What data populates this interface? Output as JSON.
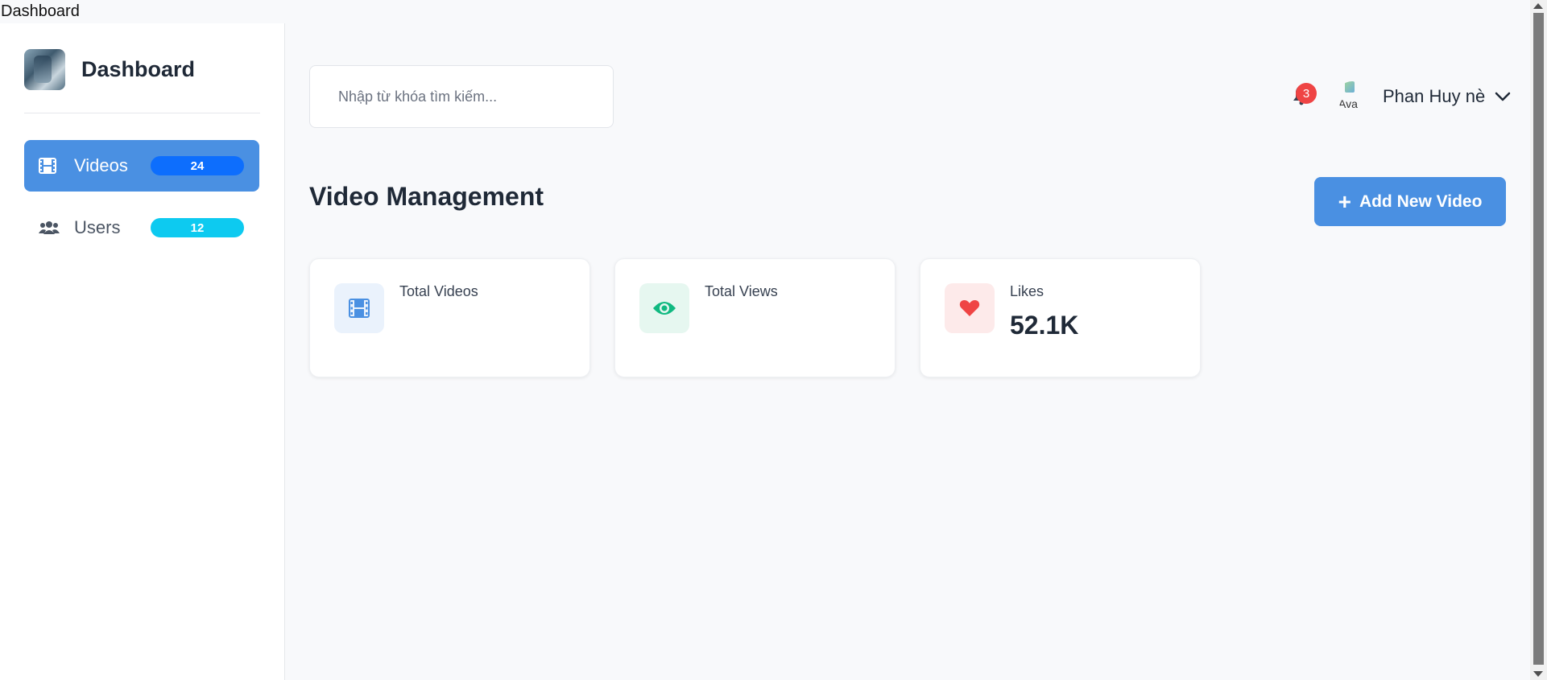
{
  "document_title": "Dashboard",
  "brand": {
    "name": "Dashboard"
  },
  "sidebar": {
    "items": [
      {
        "label": "Videos",
        "badge": "24",
        "icon": "film-icon",
        "active": true,
        "badge_color": "#0d6efd"
      },
      {
        "label": "Users",
        "badge": "12",
        "icon": "users-icon",
        "active": false,
        "badge_color": "#0dcaf0"
      }
    ]
  },
  "search": {
    "placeholder": "Nhập từ khóa tìm kiếm...",
    "value": ""
  },
  "header": {
    "notifications_count": "3",
    "avatar_alt": "Ava",
    "user_name": "Phan Huy nè"
  },
  "main": {
    "title": "Video Management",
    "add_button_label": "Add New Video",
    "stats": [
      {
        "label": "Total Videos",
        "value": "",
        "icon": "film-icon",
        "color": "#4a90e2",
        "bg": "#eaf2fc"
      },
      {
        "label": "Total Views",
        "value": "",
        "icon": "eye-icon",
        "color": "#10b981",
        "bg": "#e6f7f0"
      },
      {
        "label": "Likes",
        "value": "52.1K",
        "icon": "heart-icon",
        "color": "#ef4444",
        "bg": "#fdeaea"
      }
    ]
  },
  "colors": {
    "accent": "#4a90e2",
    "danger": "#ef4444"
  }
}
